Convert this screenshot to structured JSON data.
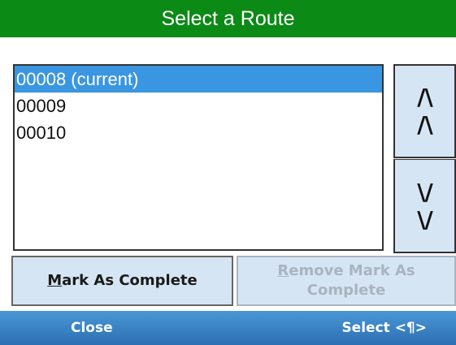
{
  "title": "Select a Route",
  "routes": [
    {
      "label": "00008 (current)",
      "selected": true
    },
    {
      "label": "00009",
      "selected": false
    },
    {
      "label": "00010",
      "selected": false
    }
  ],
  "scroll": {
    "up_line1": "/\\",
    "up_line2": "/\\",
    "down_line1": "\\/",
    "down_line2": "\\/"
  },
  "actions": {
    "mark_first": "M",
    "mark_rest": "ark As Complete",
    "remove_first": "R",
    "remove_rest": "emove Mark As",
    "remove_line2": "Complete",
    "remove_disabled": true
  },
  "softkeys": {
    "left": "Close",
    "right": "Select <¶>"
  },
  "colors": {
    "title_bg": "#0b8a16",
    "selection": "#3a96e0",
    "button_bg": "#d6e5f3",
    "softkey_bg": "#3a86c8"
  }
}
